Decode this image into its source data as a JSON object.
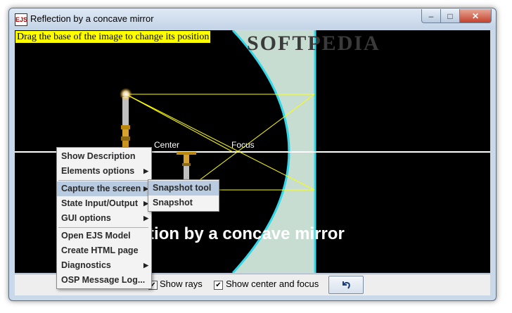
{
  "window": {
    "title": "Reflection by a concave mirror",
    "app_icon": "EJS",
    "minimize_glyph": "–",
    "maximize_glyph": "□",
    "close_glyph": "✕"
  },
  "canvas": {
    "hint": "Drag the base of the image to change its position",
    "watermark": "SOFTPEDIA",
    "center_label": "Center",
    "focus_label": "Focus",
    "caption": "Reflection by a concave mirror"
  },
  "controls": {
    "show_rays_label": "Show rays",
    "show_rays_checked": "✔",
    "show_center_focus_label": "Show center and focus",
    "show_center_focus_checked": "✔",
    "reset_icon": "undo-arrow-icon"
  },
  "context_menu": {
    "items": [
      {
        "label": "Show Description"
      },
      {
        "label": "Elements options"
      },
      {
        "label": "Capture the screen"
      },
      {
        "label": "State Input/Output"
      },
      {
        "label": "GUI options"
      },
      {
        "label": "Open EJS Model"
      },
      {
        "label": "Create HTML page"
      },
      {
        "label": "Diagnostics"
      },
      {
        "label": "OSP Message Log..."
      }
    ],
    "submenu_arrow": "▶"
  },
  "submenu": {
    "items": [
      {
        "label": "Snapshot tool"
      },
      {
        "label": "Snapshot"
      }
    ]
  },
  "colors": {
    "mirror_fill": "#c7ddd2",
    "mirror_edge": "#33d7e8",
    "rays": "#ffff00",
    "axis": "#ffffff",
    "hint_bg": "#ffff00",
    "menu_highlight": "#b8cbe0"
  }
}
